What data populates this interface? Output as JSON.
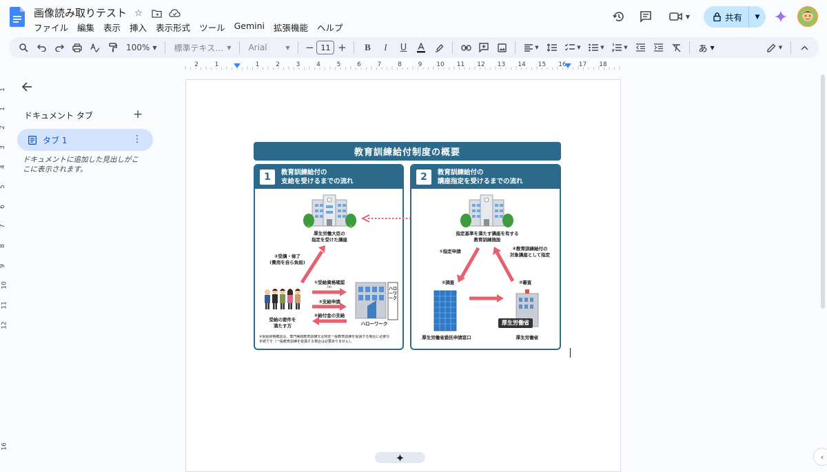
{
  "app": {
    "doc_title": "画像読み取りテスト",
    "menu": [
      "ファイル",
      "編集",
      "表示",
      "挿入",
      "表示形式",
      "ツール",
      "Gemini",
      "拡張機能",
      "ヘルプ"
    ],
    "share_label": "共有"
  },
  "toolbar": {
    "zoom": "100%",
    "style": "標準テキス…",
    "font": "Arial",
    "font_size": "11",
    "input_mode": "あ"
  },
  "ruler": {
    "horizontal": [
      "2",
      "1",
      "1",
      "2",
      "3",
      "4",
      "5",
      "6",
      "7",
      "8",
      "9",
      "10",
      "11",
      "12",
      "13",
      "14",
      "15",
      "16",
      "17",
      "18"
    ],
    "vertical": [
      "1",
      "1",
      "2",
      "3",
      "4",
      "5",
      "6",
      "7",
      "8",
      "9",
      "10",
      "11",
      "12",
      "16"
    ]
  },
  "sidebar": {
    "tabs_title": "ドキュメント タブ",
    "tab_label": "タブ 1",
    "hint": "ドキュメントに追加した見出しがここに表示されます。"
  },
  "figure": {
    "title": "教育訓練給付制度の概要",
    "panel1": {
      "number": "1",
      "title_line1": "教育訓練給付の",
      "title_line2": "支給を受けるまでの流れ",
      "top_label_line1": "厚生労働大臣の",
      "top_label_line2": "指定を受けた講座",
      "step2_line1": "②受講・修了",
      "step2_line2": "(費用を自ら負担)",
      "step1": "①受給資格確認",
      "step1_note": "(※)",
      "step3": "③支給申請",
      "step4": "④給付金の支給",
      "person_line1": "受給の要件を",
      "person_line2": "満たす方",
      "office": "ハローワーク",
      "sign": "ハローワーク",
      "note_line1": "※受給資格確認は、専門実践教育訓練又は特定一般教育訓練を受講する場合に必要な",
      "note_line2": "手続です（一般教育訓練を受講する場合は必要ありません）。"
    },
    "panel2": {
      "number": "2",
      "title_line1": "教育訓練給付の",
      "title_line2": "講座指定を受けるまでの流れ",
      "top_label_line1": "指定基準を満たす講座を有する",
      "top_label_line2": "教育訓練施設",
      "step1": "①指定申請",
      "step4_line1": "④教育訓練給付の",
      "step4_line2": "対象講座として指定",
      "step2": "②調査",
      "step3": "③審査",
      "left_org": "厚生労働省委託申請窓口",
      "right_sign": "厚生労働省",
      "right_org": "厚生労働省"
    }
  },
  "colors": {
    "accent": "#2b6a8a",
    "arrow": "#e5616f",
    "share_bg": "#c2e7ff",
    "tab_bg": "#d3e3fd"
  }
}
